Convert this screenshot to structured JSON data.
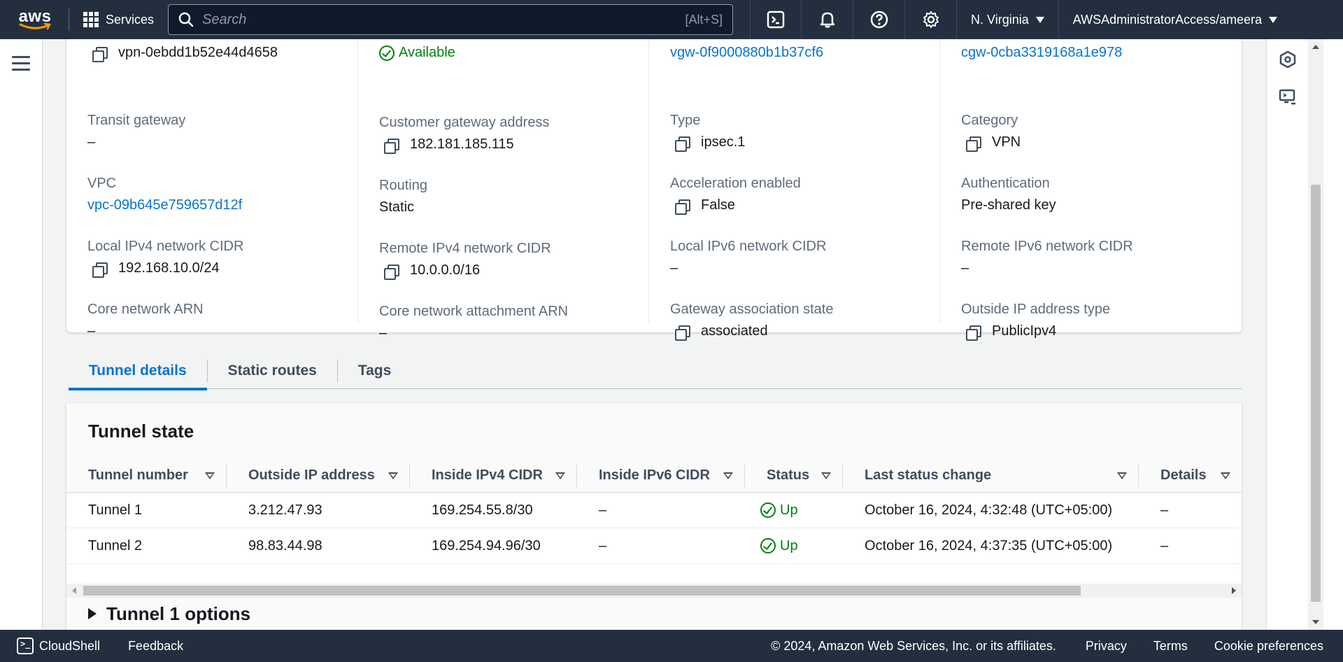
{
  "topnav": {
    "logo_text": "aws",
    "services_label": "Services",
    "search_placeholder": "Search",
    "search_shortcut": "[Alt+S]",
    "region": "N. Virginia",
    "account": "AWSAdministratorAccess/ameera"
  },
  "details": {
    "col1": [
      {
        "label": "",
        "value": "vpn-0ebdd1b52e44d4658",
        "copy": true
      },
      {
        "label": "Transit gateway",
        "value": "–"
      },
      {
        "label": "VPC",
        "value": "vpc-09b645e759657d12f",
        "link": true
      },
      {
        "label": "Local IPv4 network CIDR",
        "value": "192.168.10.0/24",
        "copy": true
      },
      {
        "label": "Core network ARN",
        "value": "–"
      }
    ],
    "col2": [
      {
        "label": "",
        "value": "Available",
        "status": true
      },
      {
        "label": "Customer gateway address",
        "value": "182.181.185.115",
        "copy": true
      },
      {
        "label": "Routing",
        "value": "Static"
      },
      {
        "label": "Remote IPv4 network CIDR",
        "value": "10.0.0.0/16",
        "copy": true
      },
      {
        "label": "Core network attachment ARN",
        "value": "–"
      }
    ],
    "col3": [
      {
        "label": "",
        "value": "vgw-0f9000880b1b37cf6",
        "link": true
      },
      {
        "label": "Type",
        "value": "ipsec.1",
        "copy": true
      },
      {
        "label": "Acceleration enabled",
        "value": "False",
        "copy": true
      },
      {
        "label": "Local IPv6 network CIDR",
        "value": "–"
      },
      {
        "label": "Gateway association state",
        "value": "associated",
        "copy": true
      }
    ],
    "col4": [
      {
        "label": "",
        "value": "cgw-0cba3319168a1e978",
        "link": true
      },
      {
        "label": "Category",
        "value": "VPN",
        "copy": true
      },
      {
        "label": "Authentication",
        "value": "Pre-shared key"
      },
      {
        "label": "Remote IPv6 network CIDR",
        "value": "–"
      },
      {
        "label": "Outside IP address type",
        "value": "PublicIpv4",
        "copy": true
      }
    ]
  },
  "tabs": [
    "Tunnel details",
    "Static routes",
    "Tags"
  ],
  "tunnel_state": {
    "title": "Tunnel state",
    "columns": [
      "Tunnel number",
      "Outside IP address",
      "Inside IPv4 CIDR",
      "Inside IPv6 CIDR",
      "Status",
      "Last status change",
      "Details"
    ],
    "rows": [
      [
        "Tunnel 1",
        "3.212.47.93",
        "169.254.55.8/30",
        "–",
        "Up",
        "October 16, 2024, 4:32:48 (UTC+05:00)",
        "–"
      ],
      [
        "Tunnel 2",
        "98.83.44.98",
        "169.254.94.96/30",
        "–",
        "Up",
        "October 16, 2024, 4:37:35 (UTC+05:00)",
        "–"
      ]
    ]
  },
  "tunnel_options_title": "Tunnel 1 options",
  "footer": {
    "cloudshell": "CloudShell",
    "feedback": "Feedback",
    "copyright": "© 2024, Amazon Web Services, Inc. or its affiliates.",
    "privacy": "Privacy",
    "terms": "Terms",
    "cookies": "Cookie preferences"
  },
  "colors": {
    "nav_bg": "#232f3e",
    "link": "#0972d3",
    "success": "#037f0c"
  }
}
